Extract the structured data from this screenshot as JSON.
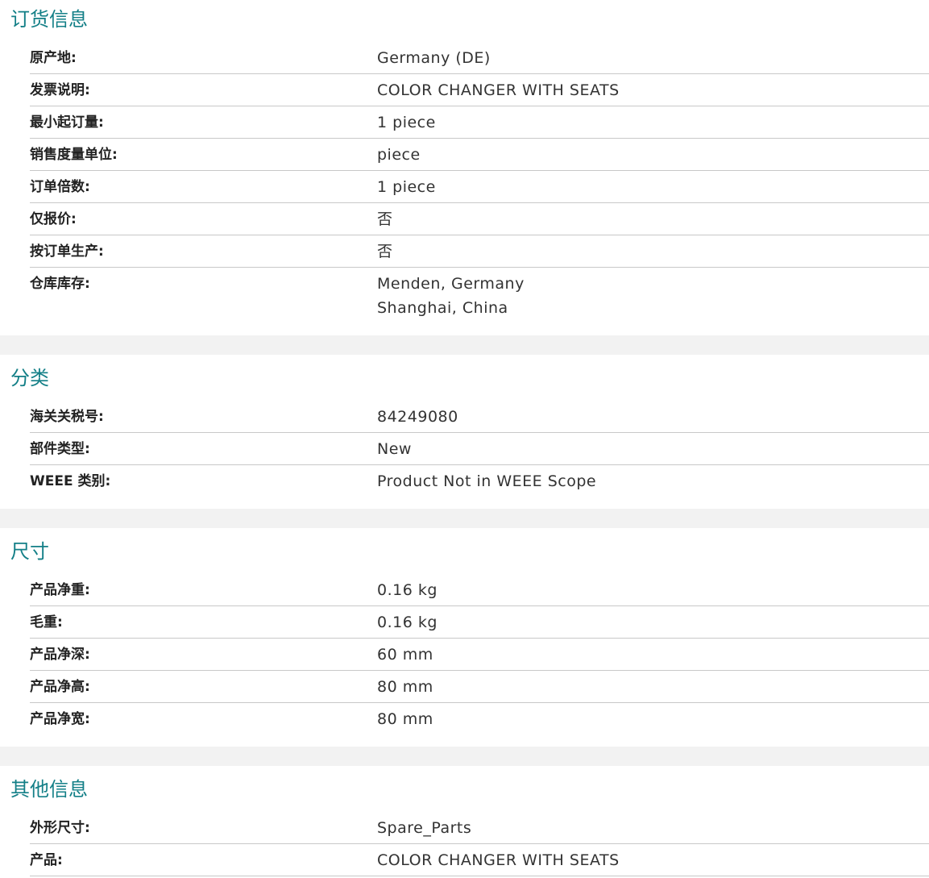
{
  "sections": [
    {
      "title": "订货信息",
      "rows": [
        {
          "label": "原产地:",
          "value": "Germany (DE)"
        },
        {
          "label": "发票说明:",
          "value": "COLOR CHANGER WITH SEATS"
        },
        {
          "label": "最小起订量:",
          "value": "1 piece"
        },
        {
          "label": "销售度量单位:",
          "value": "piece"
        },
        {
          "label": "订单倍数:",
          "value": "1 piece"
        },
        {
          "label": "仅报价:",
          "value": "否"
        },
        {
          "label": "按订单生产:",
          "value": "否"
        },
        {
          "label": "仓库库存:",
          "value": "Menden, Germany",
          "value2": "Shanghai, China"
        }
      ]
    },
    {
      "title": "分类",
      "rows": [
        {
          "label": "海关关税号:",
          "value": "84249080"
        },
        {
          "label": "部件类型:",
          "value": "New"
        },
        {
          "label": "WEEE 类别:",
          "value": "Product Not in WEEE Scope"
        }
      ]
    },
    {
      "title": "尺寸",
      "rows": [
        {
          "label": "产品净重:",
          "value": "0.16 kg"
        },
        {
          "label": "毛重:",
          "value": "0.16 kg"
        },
        {
          "label": "产品净深:",
          "value": "60 mm"
        },
        {
          "label": "产品净高:",
          "value": "80 mm"
        },
        {
          "label": "产品净宽:",
          "value": "80 mm"
        }
      ]
    },
    {
      "title": "其他信息",
      "rows": [
        {
          "label": "外形尺寸:",
          "value": "Spare_Parts"
        },
        {
          "label": "产品:",
          "value": "COLOR CHANGER WITH SEATS"
        }
      ]
    }
  ],
  "colors": {
    "section_title": "#137f87",
    "separator": "#c8c8c8",
    "gap_band": "#f2f2f2"
  }
}
